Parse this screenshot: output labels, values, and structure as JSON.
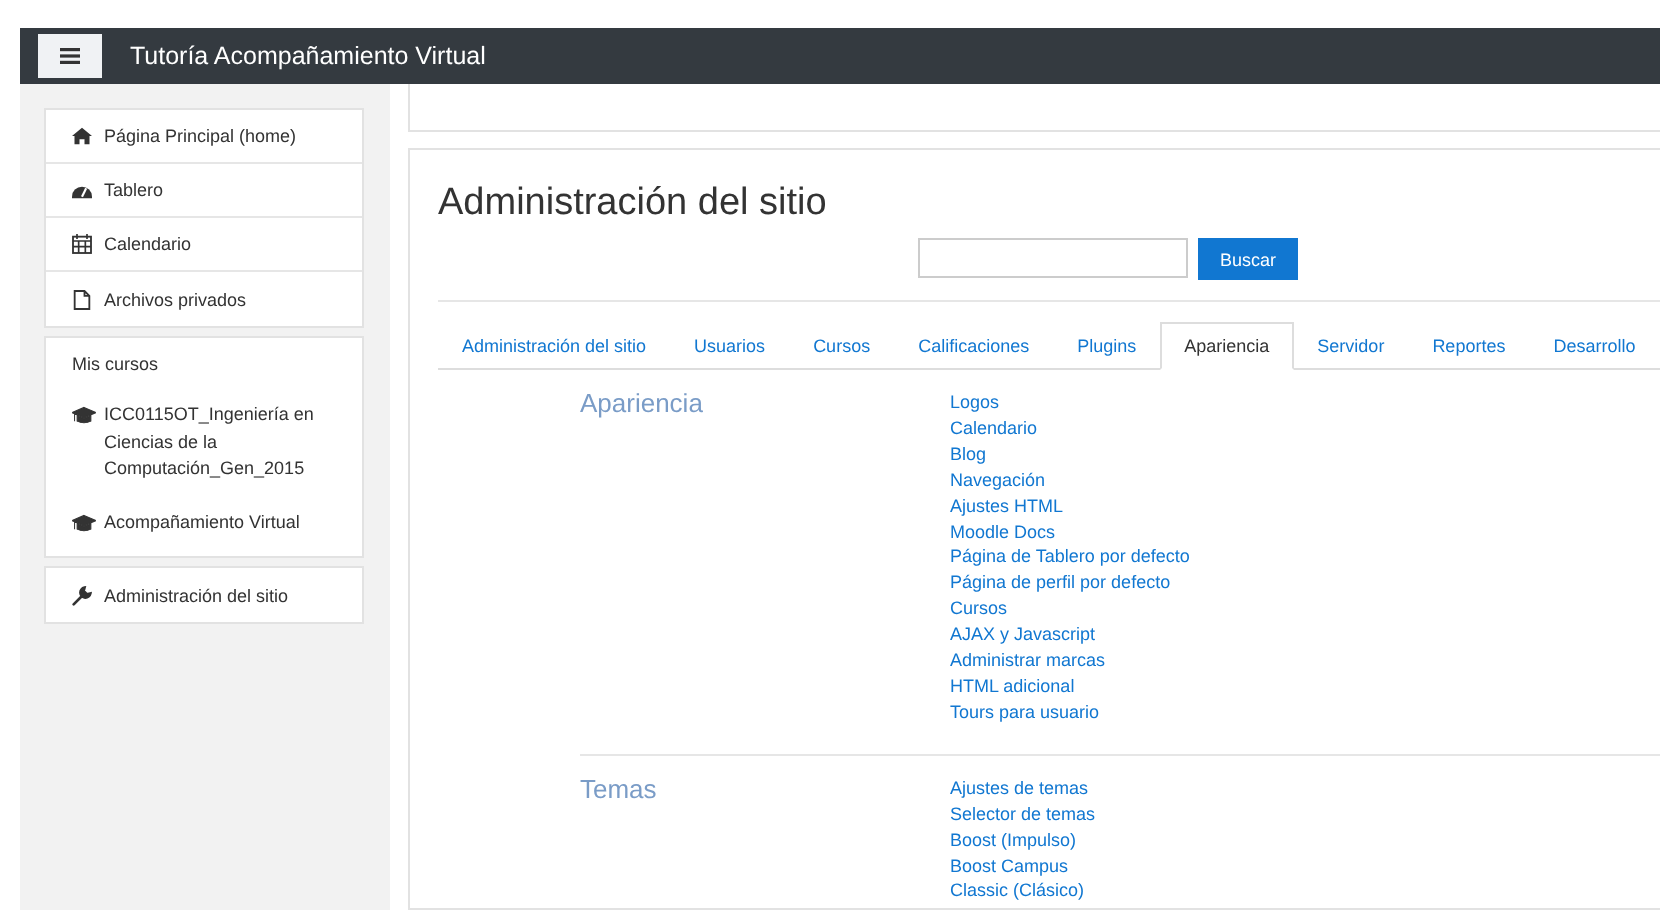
{
  "navbar": {
    "title": "Tutoría Acompañamiento Virtual"
  },
  "sidebar": {
    "nav_items": [
      {
        "label": "Página Principal (home)",
        "kind": "home"
      },
      {
        "label": "Tablero",
        "kind": "dashboard"
      },
      {
        "label": "Calendario",
        "kind": "calendar"
      },
      {
        "label": "Archivos privados",
        "kind": "file"
      }
    ],
    "my_courses": {
      "heading": "Mis cursos",
      "courses": [
        "ICC0115OT_Ingeniería en Ciencias de la Computación_Gen_2015",
        "Acompañamiento Virtual"
      ]
    },
    "admin_link": "Administración del sitio"
  },
  "page": {
    "title": "Administración del sitio",
    "search": {
      "button": "Buscar"
    },
    "tabs": [
      {
        "label": "Administración del sitio",
        "selected": false
      },
      {
        "label": "Usuarios",
        "selected": false
      },
      {
        "label": "Cursos",
        "selected": false
      },
      {
        "label": "Calificaciones",
        "selected": false
      },
      {
        "label": "Plugins",
        "selected": false
      },
      {
        "label": "Apariencia",
        "selected": true
      },
      {
        "label": "Servidor",
        "selected": false
      },
      {
        "label": "Reportes",
        "selected": false
      },
      {
        "label": "Desarrollo",
        "selected": false
      }
    ],
    "sections": [
      {
        "heading": "Apariencia",
        "links": [
          "Logos",
          "Calendario",
          "Blog",
          "Navegación",
          "Ajustes HTML",
          "Moodle Docs",
          "Página de Tablero por defecto",
          "Página de perfil por defecto",
          "Cursos",
          "AJAX y Javascript",
          "Administrar marcas",
          "HTML adicional",
          "Tours para usuario"
        ]
      },
      {
        "heading": "Temas",
        "links": [
          "Ajustes de temas",
          "Selector de temas",
          "Boost (Impulso)",
          "Boost Campus",
          "Classic (Clásico)"
        ]
      }
    ]
  }
}
